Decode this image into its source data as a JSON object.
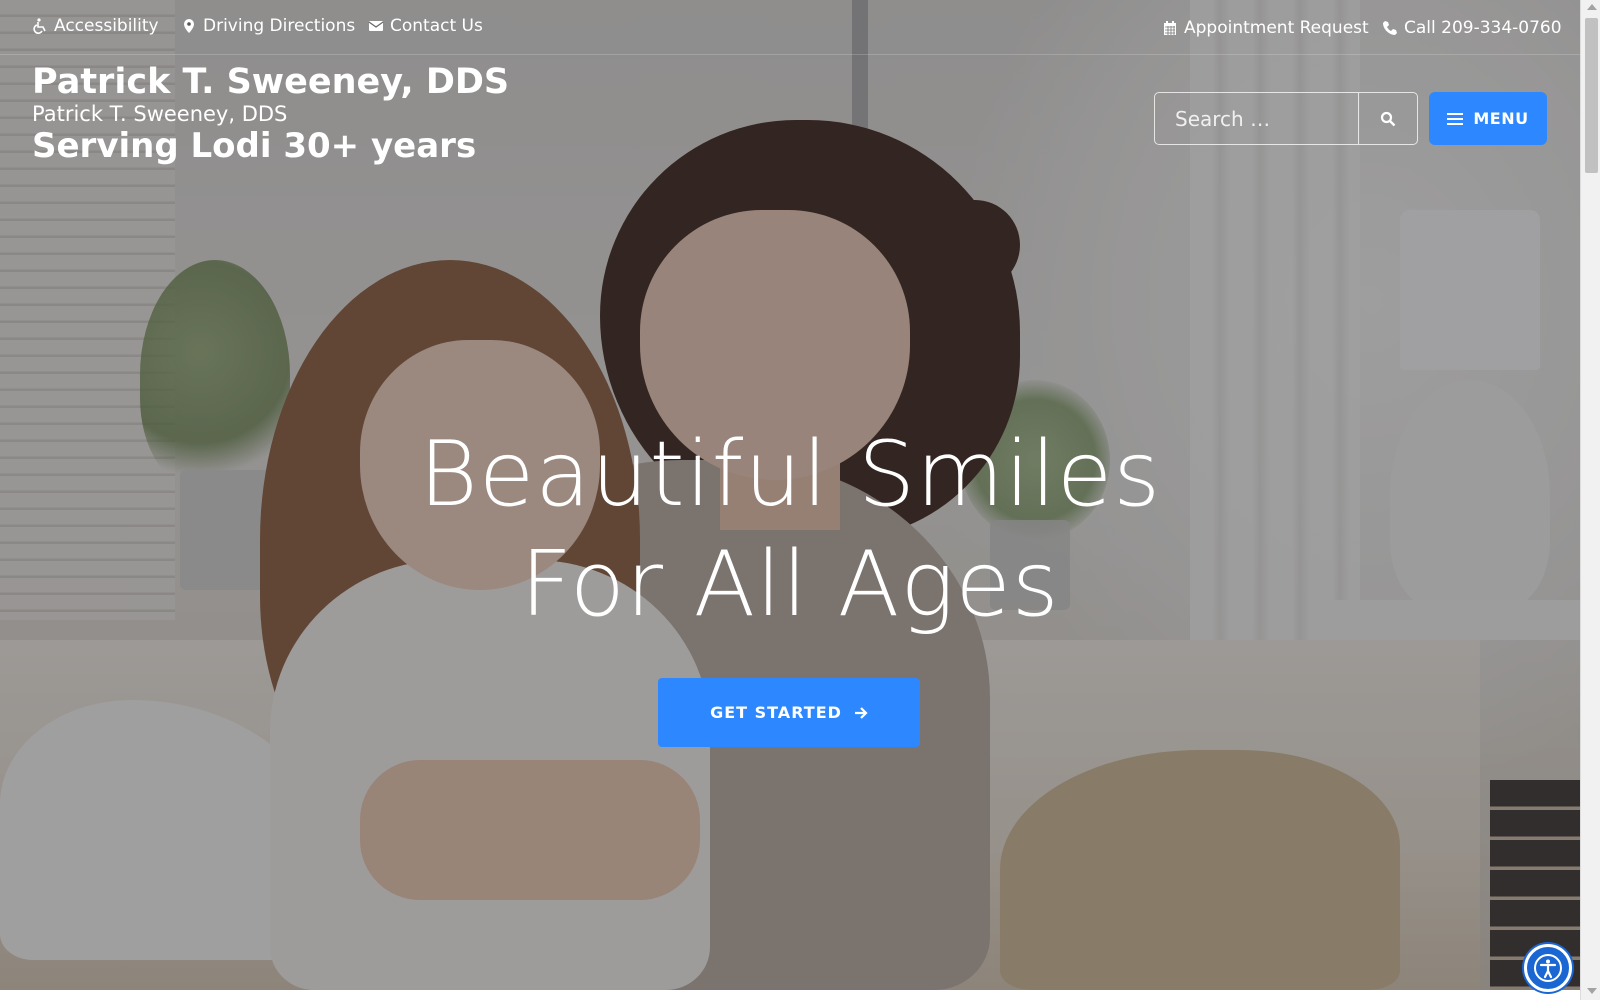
{
  "topbar": {
    "accessibility_label": "Accessibility",
    "directions_label": "Driving Directions",
    "contact_label": "Contact Us",
    "appointment_label": "Appointment Request",
    "call_label": "Call 209-334-0760"
  },
  "header": {
    "title": "Patrick T. Sweeney, DDS",
    "subtitle": "Patrick T. Sweeney, DDS",
    "tagline": "Serving Lodi 30+ years"
  },
  "search": {
    "placeholder": "Search …"
  },
  "menu": {
    "label": "MENU"
  },
  "hero": {
    "headline_line1": "Beautiful Smiles",
    "headline_line2": "For All Ages",
    "cta_label": "GET STARTED"
  },
  "colors": {
    "accent": "#2d88ff",
    "accessibility_widget": "#1a66d2"
  },
  "icons": {
    "accessibility": "wheelchair-icon",
    "directions": "map-marker-icon",
    "contact": "envelope-icon",
    "appointment": "calendar-icon",
    "call": "phone-icon",
    "search": "search-icon",
    "menu": "hamburger-icon",
    "cta": "arrow-right-icon",
    "a11y_widget": "accessibility-person-icon"
  }
}
